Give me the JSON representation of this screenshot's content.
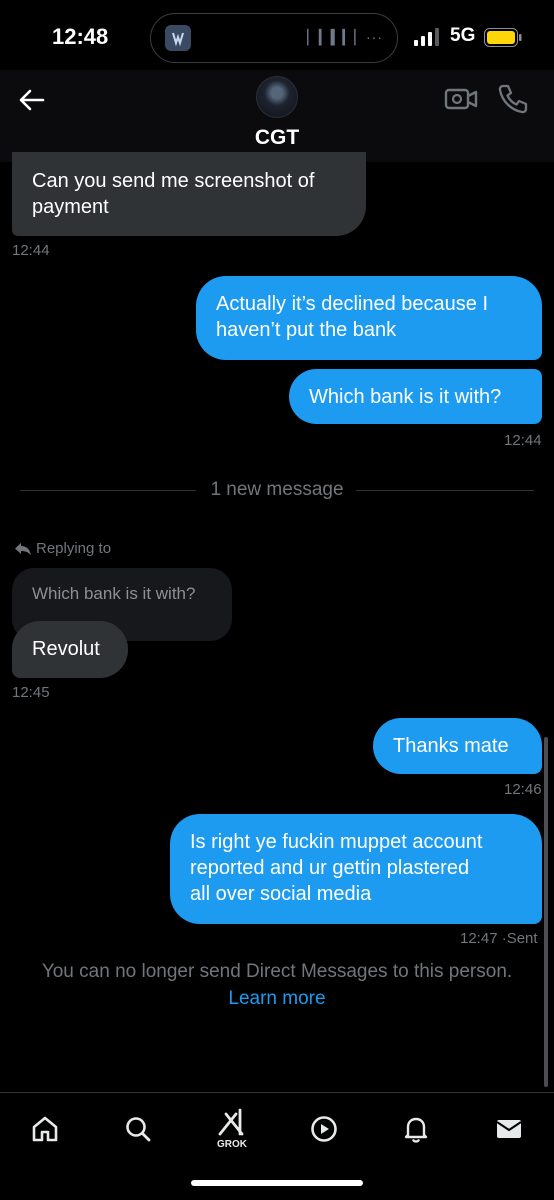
{
  "status_bar": {
    "time": "12:48",
    "network": "5G"
  },
  "header": {
    "contact_name": "CGT"
  },
  "messages": [
    {
      "direction": "in",
      "lines": [
        "Can you send me screenshot of",
        "payment"
      ],
      "time": "12:44"
    },
    {
      "direction": "out",
      "lines": [
        "Actually it’s declined because I",
        "haven’t put the bank"
      ]
    },
    {
      "direction": "out",
      "lines": [
        "Which bank is it with?"
      ],
      "time": "12:44"
    },
    {
      "direction": "in",
      "replying_label": "Replying to",
      "quoted_text": "Which bank is it with?",
      "lines": [
        "Revolut"
      ],
      "time": "12:45"
    },
    {
      "direction": "out",
      "lines": [
        "Thanks mate"
      ],
      "time": "12:46"
    },
    {
      "direction": "out",
      "lines": [
        "Is right ye fuckin muppet account",
        "reported and ur gettin plastered",
        "all over social media"
      ],
      "time": "12:47",
      "status": "·Sent"
    }
  ],
  "divider": {
    "text": "1 new message"
  },
  "notice": {
    "text": "You can no longer send Direct Messages to this person.",
    "link_text": "Learn more"
  },
  "tabbar": {
    "items": [
      {
        "icon": "home-icon"
      },
      {
        "icon": "search-icon"
      },
      {
        "icon": "grok-icon",
        "label": "GROK"
      },
      {
        "icon": "play-icon"
      },
      {
        "icon": "bell-icon"
      },
      {
        "icon": "mail-icon"
      }
    ]
  },
  "colors": {
    "accent": "#1d9bf0",
    "incoming_bubble": "#2f3336",
    "background": "#000000",
    "muted": "#71767b",
    "battery": "#ffd60a"
  }
}
